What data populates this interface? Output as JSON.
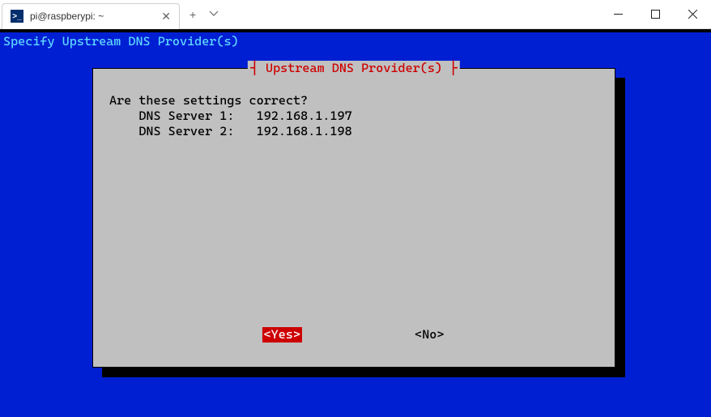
{
  "window": {
    "tab_title": "pi@raspberypi: ~",
    "tab_icon_text": ">_"
  },
  "terminal": {
    "header_line": "Specify Upstream DNS Provider(s)",
    "dialog": {
      "title": "Upstream DNS Provider(s)",
      "prompt": "Are these settings correct?",
      "settings": [
        {
          "label": "DNS Server 1:",
          "value": "192.168.1.197"
        },
        {
          "label": "DNS Server 2:",
          "value": "192.168.1.198"
        }
      ],
      "yes_label": "<Yes>",
      "no_label": "<No>"
    }
  }
}
